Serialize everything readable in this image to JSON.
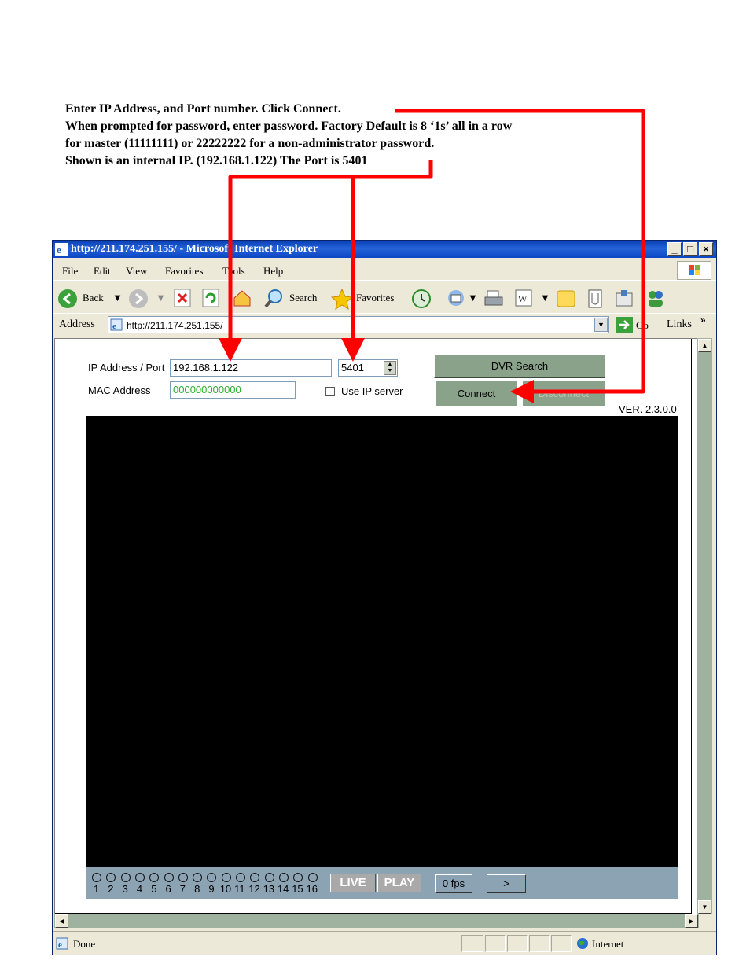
{
  "instructions": {
    "line1": "Enter IP Address, and Port number. Click Connect.",
    "line2": "When prompted for password, enter password. Factory Default is 8 ‘1s’ all in a row",
    "line3": "for master (11111111) or 22222222 for a non-administrator password.",
    "line4": "Shown is an internal IP. (192.168.1.122) The Port is 5401"
  },
  "window": {
    "title": "http://211.174.251.155/ - Microsoft Internet Explorer",
    "controls": {
      "minimize": "_",
      "maximize": "□",
      "close": "×"
    }
  },
  "menu": [
    "File",
    "Edit",
    "View",
    "Favorites",
    "Tools",
    "Help"
  ],
  "toolbar": {
    "back": "Back",
    "search": "Search",
    "favorites": "Favorites"
  },
  "address": {
    "label": "Address",
    "url": "http://211.174.251.155/",
    "go": "Go",
    "links": "Links",
    "more": "»"
  },
  "dvr": {
    "ip_label": "IP Address / Port",
    "ip_value": "192.168.1.122",
    "port_value": "5401",
    "mac_label": "MAC Address",
    "mac_value": "000000000000",
    "use_ip_server": "Use IP server",
    "dvr_search": "DVR Search",
    "connect": "Connect",
    "disconnect": "Disconnect",
    "version": "VER. 2.3.0.0",
    "channels": [
      "1",
      "2",
      "3",
      "4",
      "5",
      "6",
      "7",
      "8",
      "9",
      "10",
      "11",
      "12",
      "13",
      "14",
      "15",
      "16"
    ],
    "live": "LIVE",
    "play": "PLAY",
    "fps": "0 fps",
    "next": ">"
  },
  "status": {
    "text": "Done",
    "zone": "Internet"
  },
  "colors": {
    "arrow": "#FF0000",
    "title_bar": "#0A3FB5",
    "dvr_button": "#8BA28A",
    "video": "#000000"
  }
}
